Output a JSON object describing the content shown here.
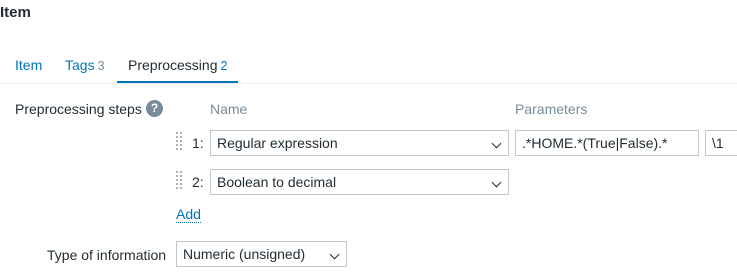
{
  "page": {
    "title": "Item"
  },
  "tabs": [
    {
      "label": "Item",
      "count": ""
    },
    {
      "label": "Tags",
      "count": "3"
    },
    {
      "label": "Preprocessing",
      "count": "2"
    }
  ],
  "preprocessing": {
    "label": "Preprocessing steps",
    "help": "?",
    "col_name": "Name",
    "col_params": "Parameters",
    "steps": [
      {
        "num": "1:",
        "type": "Regular expression",
        "param1": ".*HOME.*(True|False).*",
        "param2": "\\1"
      },
      {
        "num": "2:",
        "type": "Boolean to decimal"
      }
    ],
    "add_label": "Add"
  },
  "type_of_information": {
    "label": "Type of information",
    "value": "Numeric (unsigned)"
  }
}
